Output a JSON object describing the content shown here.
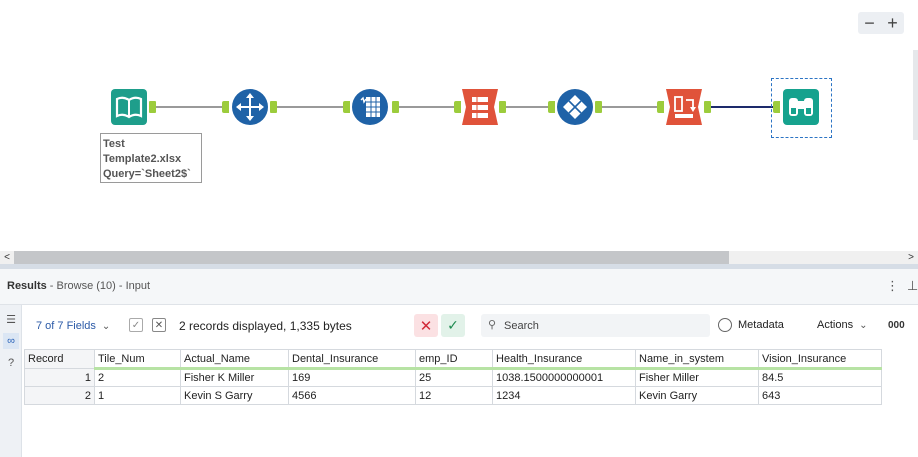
{
  "canvas": {
    "zoom_out": "−",
    "zoom_in": "+",
    "annotation": [
      "Test",
      "Template2.xlsx",
      "Query=`Sheet2$`"
    ],
    "tools": [
      {
        "name": "input-data-tool",
        "color": "#1e9e8b"
      },
      {
        "name": "select-tool",
        "color": "#1f62a7"
      },
      {
        "name": "formula-tool",
        "color": "#1f62a7"
      },
      {
        "name": "join-tool",
        "color": "#e0533a"
      },
      {
        "name": "unique-tool",
        "color": "#1f62a7"
      },
      {
        "name": "transpose-tool",
        "color": "#e0533a"
      },
      {
        "name": "browse-tool",
        "color": "#16a28e"
      }
    ]
  },
  "scrollbar": {
    "left": "<",
    "right": ">"
  },
  "results": {
    "title": "Results",
    "subtitle": " - Browse (10) - Input",
    "fields_label": "7 of 7 Fields",
    "records_info": "2 records displayed, 1,335 bytes",
    "search_placeholder": "Search",
    "metadata_label": "Metadata",
    "actions_label": "Actions",
    "more_label": "000"
  },
  "grid": {
    "columns": [
      "Record",
      "Tile_Num",
      "Actual_Name",
      "Dental_Insurance",
      "emp_ID",
      "Health_Insurance",
      "Name_in_system",
      "Vision_Insurance"
    ],
    "rows": [
      [
        "1",
        "2",
        "Fisher K Miller",
        "169",
        "25",
        "1038.1500000000001",
        "Fisher Miller",
        "84.5"
      ],
      [
        "2",
        "1",
        "Kevin S Garry",
        "4566",
        "12",
        "1234",
        "Kevin Garry",
        "643"
      ]
    ]
  }
}
